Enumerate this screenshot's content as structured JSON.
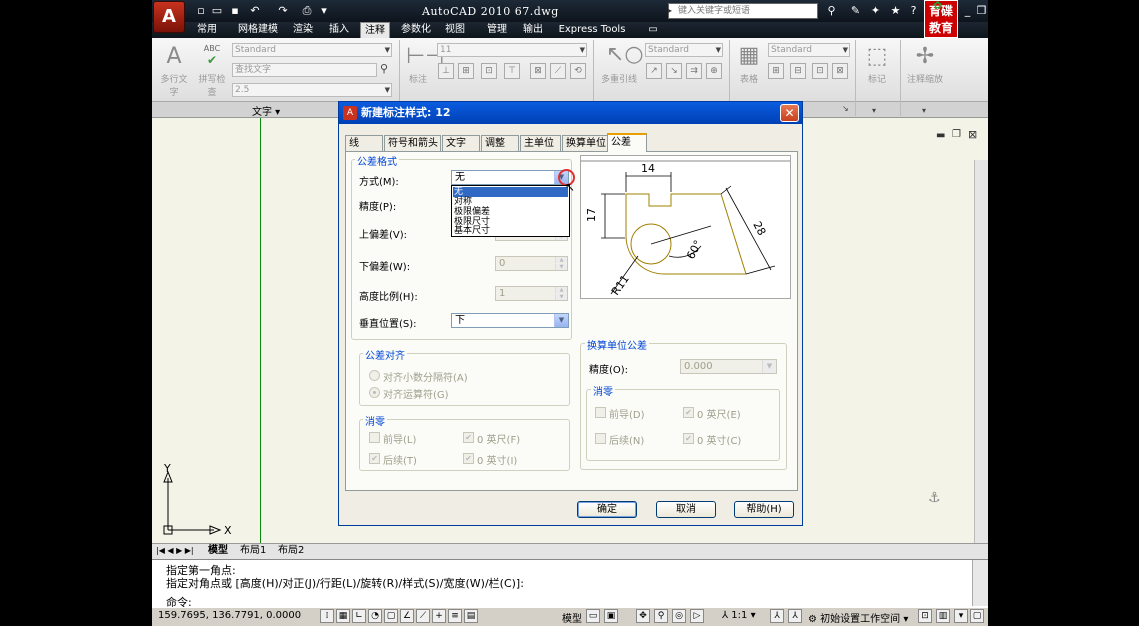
{
  "app": {
    "logo_letter": "A",
    "window_title": "AutoCAD 2010   67.dwg",
    "search_placeholder": "键入关键字或短语",
    "brand_text": "育碟教育",
    "ribbon_tabs": [
      "常用",
      "网格建模",
      "渲染",
      "插入",
      "注释",
      "参数化",
      "视图",
      "管理",
      "输出",
      "Express Tools"
    ],
    "active_tab": "注释"
  },
  "ribbon": {
    "text_panel": {
      "multiline_label": "多行文字",
      "spell_label": "拼写检查",
      "style_combo": "Standard",
      "find_combo": "查找文字",
      "height_combo": "2.5",
      "panel_label": "文字"
    },
    "dim_panel": {
      "dim_label": "标注",
      "style_combo": "11"
    },
    "leader_panel": {
      "label": "多重引线",
      "style_combo": "Standard"
    },
    "table_panel": {
      "label": "表格",
      "style_combo": "Standard"
    },
    "mark_label": "标记",
    "scale_label": "注释缩放"
  },
  "layout_tabs": [
    "模型",
    "布局1",
    "布局2"
  ],
  "command": {
    "line1": "指定第一角点:",
    "line2": "指定对角点或 [高度(H)/对正(J)/行距(L)/旋转(R)/样式(S)/宽度(W)/栏(C)]:",
    "prompt": "命令:"
  },
  "status": {
    "coords": "159.7695, 136.7791, 0.0000",
    "model": "模型",
    "scale": "1:1",
    "workspace": "初始设置工作空间"
  },
  "ucs": {
    "x": "X",
    "y": "Y"
  },
  "dialog": {
    "title": "新建标注样式: 12",
    "tabs": [
      "线",
      "符号和箭头",
      "文字",
      "调整",
      "主单位",
      "换算单位",
      "公差"
    ],
    "active_tab": "公差",
    "tolerance_format": {
      "title": "公差格式",
      "method_label": "方式(M):",
      "method_value": "无",
      "method_options": [
        "无",
        "对称",
        "极限偏差",
        "极限尺寸",
        "基本尺寸"
      ],
      "precision_label": "精度(P):",
      "upper_label": "上偏差(V):",
      "lower_label": "下偏差(W):",
      "lower_value": "0",
      "height_label": "高度比例(H):",
      "height_value": "1",
      "vpos_label": "垂直位置(S):",
      "vpos_value": "下"
    },
    "tolerance_align": {
      "title": "公差对齐",
      "opt1": "对齐小数分隔符(A)",
      "opt2": "对齐运算符(G)"
    },
    "zero_suppress": {
      "title": "消零",
      "leading": "前导(L)",
      "trailing": "后续(T)",
      "feet": "0 英尺(F)",
      "inches": "0 英寸(I)"
    },
    "alt_unit": {
      "title": "换算单位公差",
      "precision_label": "精度(O):",
      "precision_value": "0.000",
      "zero_title": "消零",
      "leading": "前导(D)",
      "trailing": "后续(N)",
      "feet": "0 英尺(E)",
      "inches": "0 英寸(C)"
    },
    "preview": {
      "dim_top": "14",
      "dim_left": "17",
      "dim_diag": "28",
      "dim_angle": "60°",
      "dim_radius": "R11"
    },
    "buttons": {
      "ok": "确定",
      "cancel": "取消",
      "help": "帮助(H)"
    }
  }
}
